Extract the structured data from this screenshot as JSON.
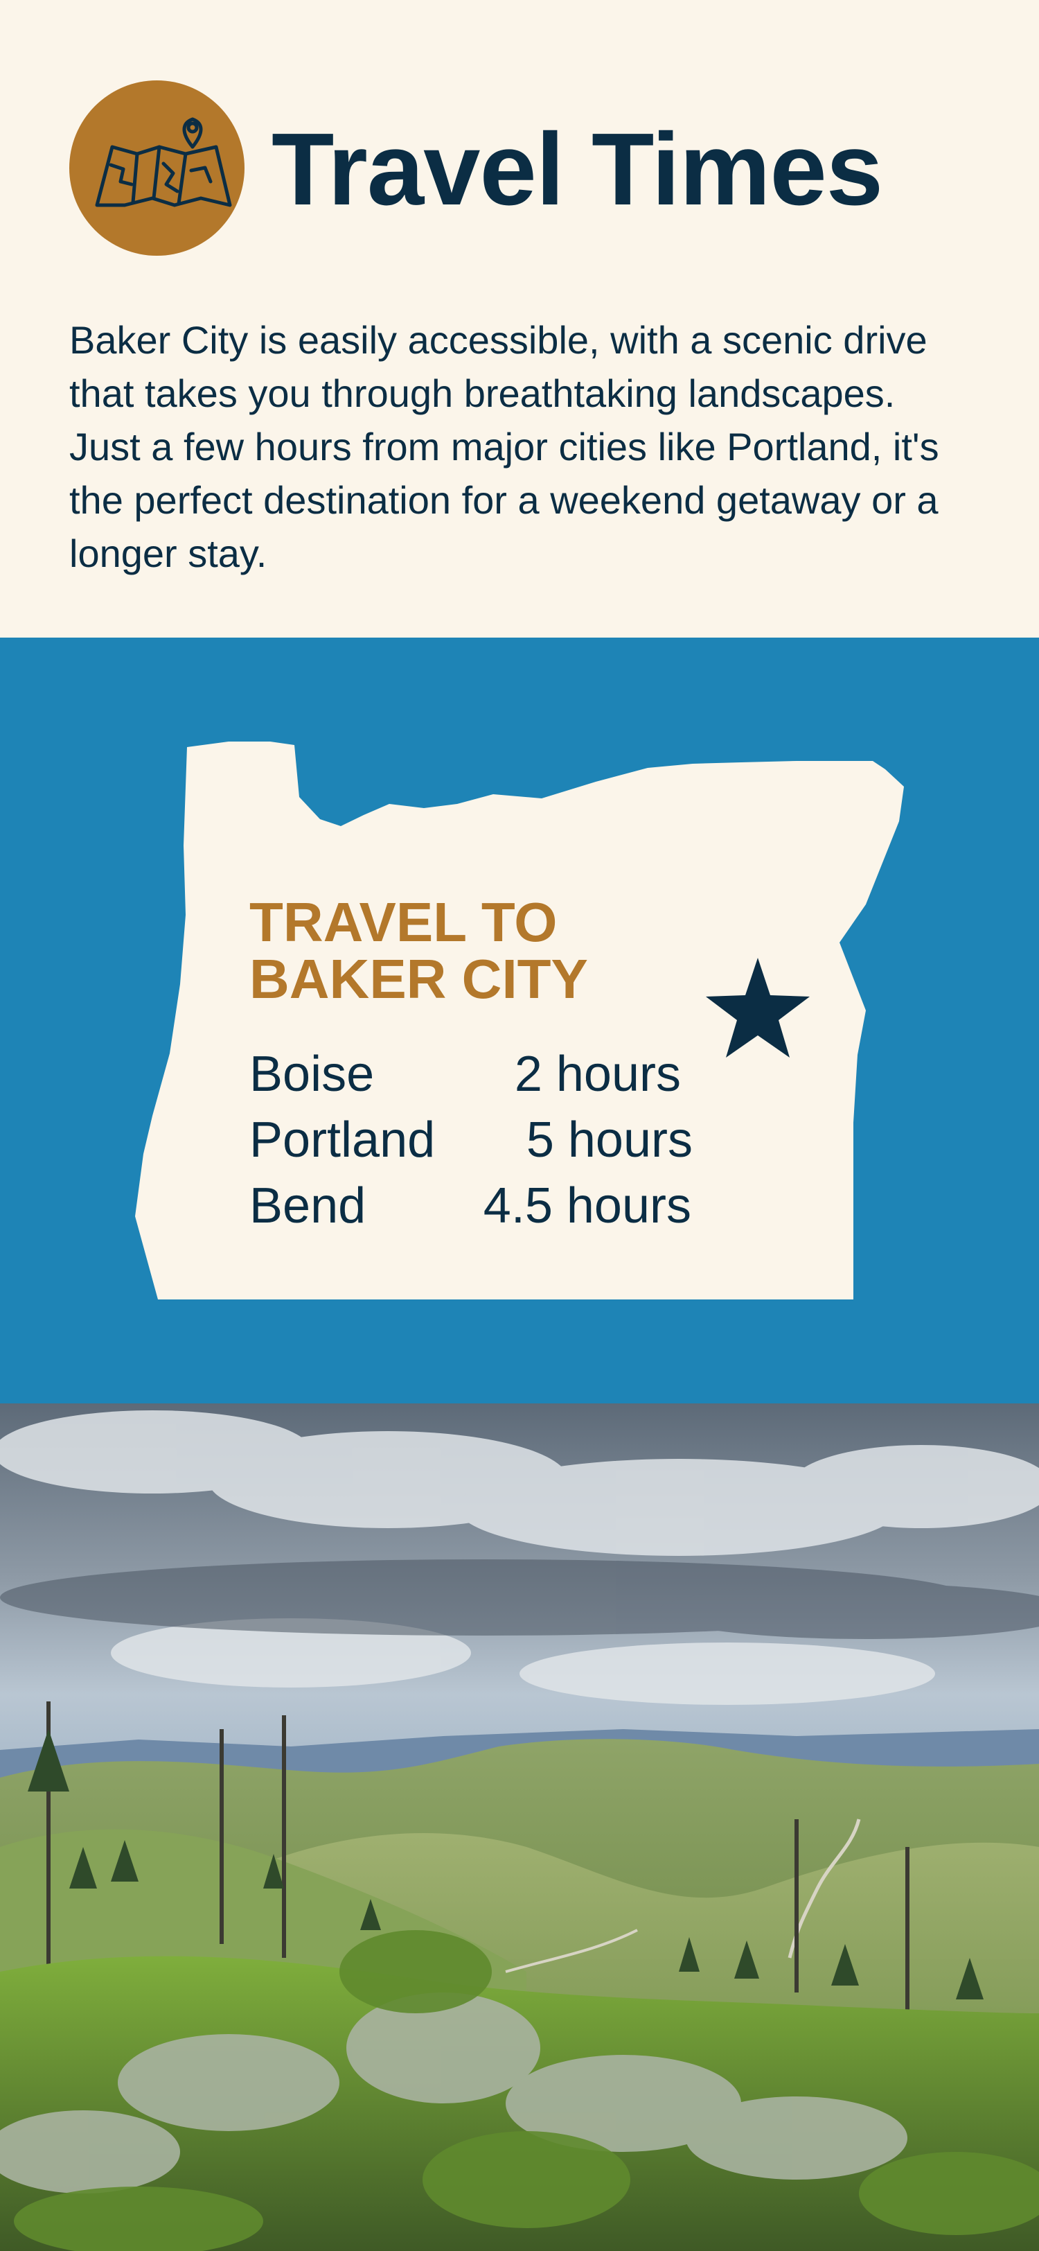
{
  "header": {
    "icon": "folded-map-pin-icon",
    "title": "Travel Times"
  },
  "intro": "Baker City is easily accessible, with a scenic drive that takes you through breathtaking landscapes. Just a few hours from major cities like Portland, it's the perfect destination for a weekend getaway or a longer stay.",
  "map": {
    "shape": "oregon-state-silhouette",
    "heading_line1": "TRAVEL TO",
    "heading_line2": "BAKER CITY",
    "marker": "star-icon",
    "routes": [
      {
        "city": "Boise",
        "time": "2 hours"
      },
      {
        "city": "Portland",
        "time": "5 hours"
      },
      {
        "city": "Bend",
        "time": "4.5 hours"
      }
    ]
  },
  "photo": {
    "subject": "landscape-photo"
  },
  "colors": {
    "cream": "#fbf5ea",
    "navy": "#0b2d44",
    "gold": "#b3782b",
    "blue": "#1e84b6"
  }
}
